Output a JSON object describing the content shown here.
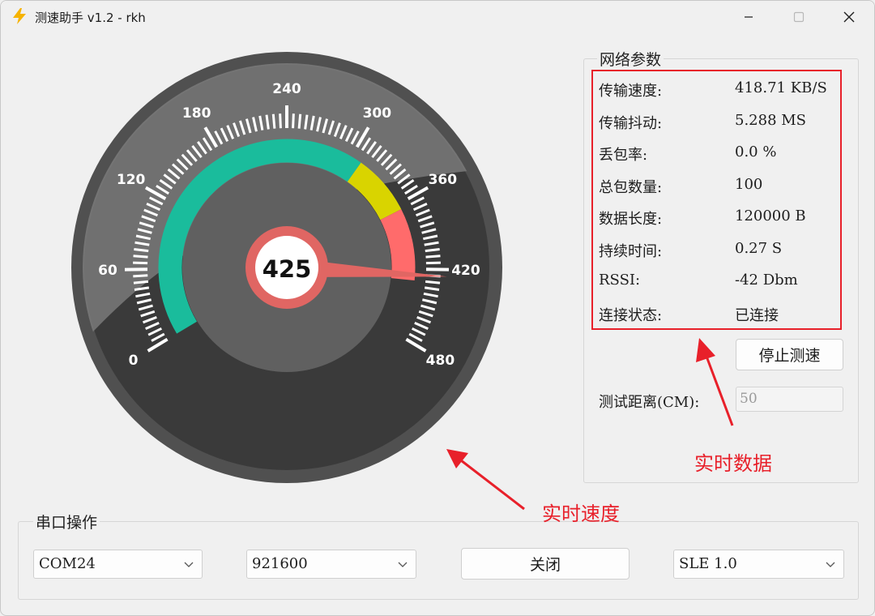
{
  "window": {
    "title": "测速助手 v1.2 - rkh",
    "icon": "lightning-icon",
    "controls": [
      "minimize-icon",
      "maximize-icon",
      "close-icon"
    ]
  },
  "gauge": {
    "value_label": "425",
    "value": 425,
    "min": 0,
    "max": 480,
    "tick_labels": [
      "0",
      "60",
      "120",
      "180",
      "240",
      "300",
      "360",
      "420",
      "480"
    ],
    "bands": [
      {
        "from": 0,
        "to": 310,
        "color": "#1abc9c"
      },
      {
        "from": 310,
        "to": 365,
        "color": "#d9d400"
      },
      {
        "from": 365,
        "to": 430,
        "color": "#ff6b6b"
      }
    ]
  },
  "network_params": {
    "title": "网络参数",
    "rows": [
      {
        "label": "传输速度:",
        "value": "418.71 KB/S"
      },
      {
        "label": "传输抖动:",
        "value": "5.288 MS"
      },
      {
        "label": "丢包率:",
        "value": "0.0 %"
      },
      {
        "label": "总包数量:",
        "value": "100"
      },
      {
        "label": "数据长度:",
        "value": "120000 B"
      },
      {
        "label": "持续时间:",
        "value": "0.27 S"
      },
      {
        "label": "RSSI:",
        "value": "-42 Dbm"
      },
      {
        "label": "连接状态:",
        "value": "已连接"
      }
    ],
    "stop_button": "停止测速",
    "distance_label": "测试距离(CM):",
    "distance_value": "50"
  },
  "serial": {
    "title": "串口操作",
    "port": "COM24",
    "baud": "921600",
    "close_button": "关闭",
    "protocol": "SLE 1.0"
  },
  "annotations": {
    "realtime_data": "实时数据",
    "realtime_speed": "实时速度",
    "color": "#e8202a"
  }
}
